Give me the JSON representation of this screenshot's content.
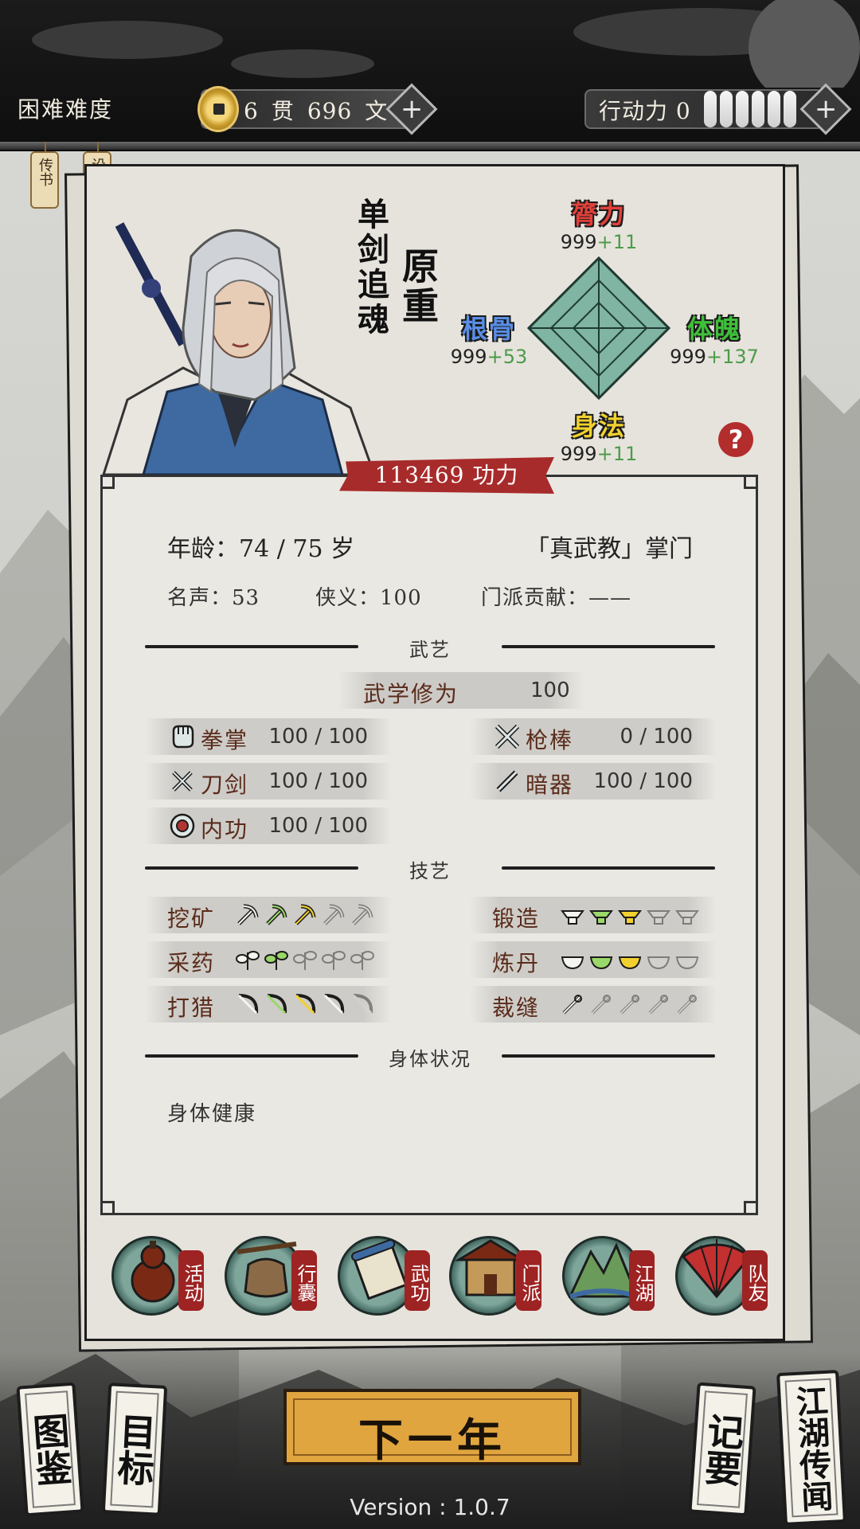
{
  "topbar": {
    "difficulty": "困难难度",
    "money_guan": "6",
    "money_guan_unit": "贯",
    "money_wen": "696",
    "money_wen_unit": "文",
    "action_label": "行动力 0",
    "energy_slots_total": 6
  },
  "hang_tags": [
    "传书",
    "设置"
  ],
  "character": {
    "title": "单剑追魂",
    "name": "原重",
    "power": "113469 功力"
  },
  "stats": {
    "top": {
      "name": "膂力",
      "base": "999",
      "bonus": "+11",
      "color": "#e2403a"
    },
    "left": {
      "name": "根骨",
      "base": "999",
      "bonus": "+53",
      "color": "#5a8ee6"
    },
    "right": {
      "name": "体魄",
      "base": "999",
      "bonus": "+137",
      "color": "#3fbf3a"
    },
    "bottom": {
      "name": "身法",
      "base": "999",
      "bonus": "+11",
      "color": "#f2d12e"
    }
  },
  "info": {
    "age": "年龄：74 / 75 岁",
    "sect_role": "「真武教」掌门",
    "fame": "名声：53",
    "chivalry": "侠义：100",
    "contribution": "门派贡献：——"
  },
  "sections": {
    "martial": "武艺",
    "craft": "技艺",
    "body": "身体状况"
  },
  "mastery": {
    "label": "武学修为",
    "value": "100"
  },
  "martial_skills": [
    {
      "name": "拳掌",
      "value": "100 / 100",
      "icon": "fist-icon"
    },
    {
      "name": "枪棒",
      "value": "0 / 100",
      "icon": "spear-icon"
    },
    {
      "name": "刀剑",
      "value": "100 / 100",
      "icon": "swords-icon"
    },
    {
      "name": "暗器",
      "value": "100 / 100",
      "icon": "dart-icon"
    },
    {
      "name": "内功",
      "value": "100 / 100",
      "icon": "inner-energy-icon"
    }
  ],
  "crafts": [
    {
      "name": "挖矿",
      "level": 3,
      "max": 5,
      "icon": "pickaxe-icon"
    },
    {
      "name": "锻造",
      "level": 3,
      "max": 5,
      "icon": "anvil-icon"
    },
    {
      "name": "采药",
      "level": 2,
      "max": 5,
      "icon": "herb-icon"
    },
    {
      "name": "炼丹",
      "level": 3,
      "max": 5,
      "icon": "mortar-icon"
    },
    {
      "name": "打猎",
      "level": 4,
      "max": 5,
      "icon": "bow-icon"
    },
    {
      "name": "裁缝",
      "level": 1,
      "max": 5,
      "icon": "needle-icon"
    }
  ],
  "body_status": "身体健康",
  "menu": [
    "活动",
    "行囊",
    "武功",
    "门派",
    "江湖",
    "队友"
  ],
  "bottom": {
    "left1": "图鉴",
    "left2": "目标",
    "next_year": "下一年",
    "right1": "记要",
    "right2": "江湖传闻",
    "version": "Version : 1.0.7"
  }
}
